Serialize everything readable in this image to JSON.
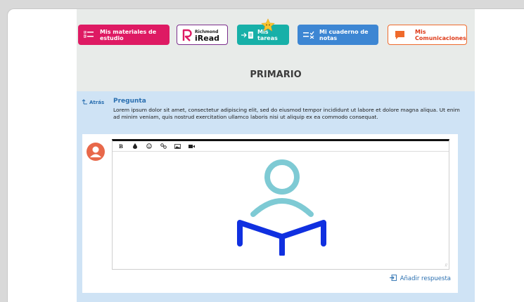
{
  "nav": {
    "materials": "Mis materiales de estudio",
    "iread_top": "Richmond",
    "iread_bottom": "iRead",
    "tareas": "Mis tareas",
    "cuaderno": "Mi cuaderno de notas",
    "comms": "Mis Comunicaciones"
  },
  "page": {
    "title": "PRIMARIO"
  },
  "question": {
    "back": "Atrás",
    "heading": "Pregunta",
    "text": "Lorem ipsum dolor sit amet, consectetur adipiscing elit, sed do eiusmod tempor incididunt ut labore et dolore magna aliqua. Ut enim ad minim veniam, quis nostrud exercitation ullamco laboris nisi ut aliquip ex ea commodo consequat."
  },
  "editor": {
    "tools": [
      "B",
      "drop-icon",
      "emoji-icon",
      "link-icon",
      "image-icon",
      "video-icon"
    ],
    "bold_label": "B"
  },
  "reply": {
    "add_label": "Añadir respuesta"
  },
  "colors": {
    "materials": "#de1a63",
    "tareas": "#17b0a8",
    "cuaderno": "#3d86d3",
    "comms": "#ef6a2c",
    "accent_blue": "#2a6fb0",
    "illus_head": "#7ecad4",
    "illus_book": "#1030e0"
  }
}
